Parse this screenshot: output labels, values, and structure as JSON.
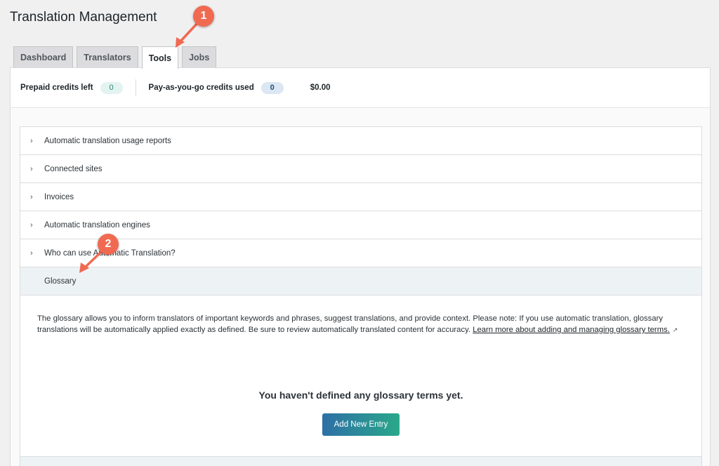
{
  "page": {
    "title": "Translation Management"
  },
  "tabs": [
    {
      "label": "Dashboard",
      "active": false
    },
    {
      "label": "Translators",
      "active": false
    },
    {
      "label": "Tools",
      "active": true
    },
    {
      "label": "Jobs",
      "active": false
    }
  ],
  "credits": {
    "prepaid_label": "Prepaid credits left",
    "prepaid_value": "0",
    "payg_label": "Pay-as-you-go credits used",
    "payg_value": "0",
    "amount": "$0.00"
  },
  "accordion": {
    "items": [
      {
        "label": "Automatic translation usage reports"
      },
      {
        "label": "Connected sites"
      },
      {
        "label": "Invoices"
      },
      {
        "label": "Automatic translation engines"
      },
      {
        "label": "Who can use Automatic Translation?"
      }
    ],
    "open_item": {
      "label": "Glossary",
      "description": "The glossary allows you to inform translators of important keywords and phrases, suggest translations, and provide context. Please note: If you use automatic translation, glossary translations will be automatically applied exactly as defined. Be sure to review automatically translated content for accuracy.",
      "link_text": "Learn more about adding and managing glossary terms.",
      "empty_message": "You haven't defined any glossary terms yet.",
      "add_button": "Add New Entry"
    }
  },
  "annotations": [
    {
      "number": "1"
    },
    {
      "number": "2"
    }
  ],
  "colors": {
    "accent_gradient_start": "#2d6fa6",
    "accent_gradient_end": "#2aa889",
    "callout": "#f06a52"
  }
}
